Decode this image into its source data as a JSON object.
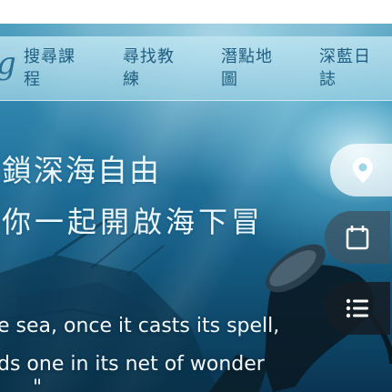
{
  "navbar": {
    "logo_glyph": "g",
    "items": [
      {
        "label": "搜尋課程"
      },
      {
        "label": "尋找教練"
      },
      {
        "label": "潛點地圖"
      },
      {
        "label": "深藍日誌"
      }
    ]
  },
  "hero": {
    "title_line1": "鎖深海自由",
    "title_line2": "你一起開啟海下冒",
    "quote_line1": "e sea, once it casts its spell,",
    "quote_line2": "ds one in its net of wonder",
    "quote_line3": "\""
  },
  "side_actions": [
    {
      "icon": "location-pin-icon"
    },
    {
      "icon": "calendar-icon"
    },
    {
      "icon": "list-icon"
    }
  ],
  "colors": {
    "nav_text": "#1f5e80",
    "hero_text": "#eaf7fc",
    "fab_light": "#ffffff",
    "fab_mid": "#3c5564",
    "fab_dark": "#141e26"
  }
}
